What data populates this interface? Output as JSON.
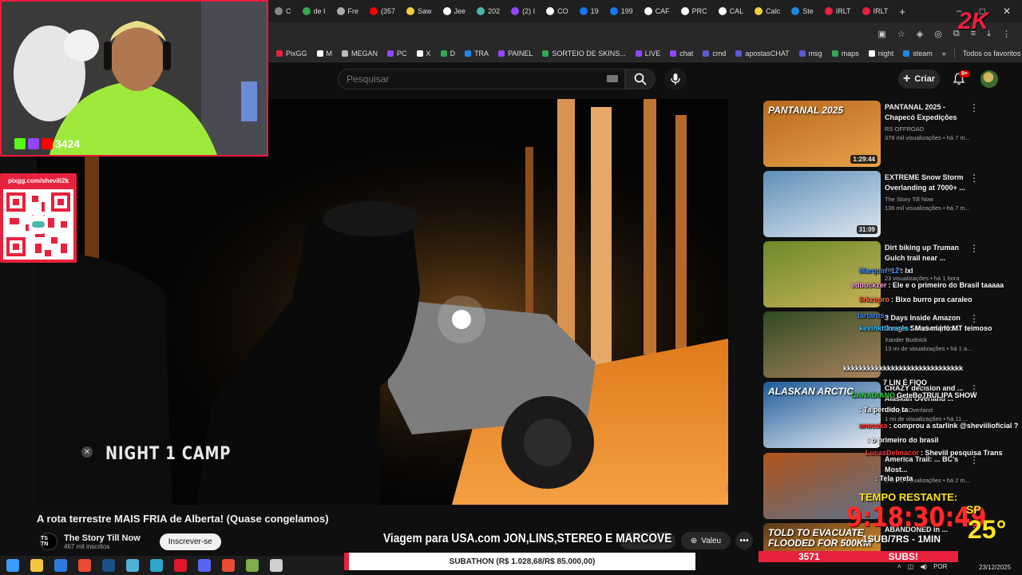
{
  "browser": {
    "tabs": [
      {
        "label": "C",
        "color": "#888888"
      },
      {
        "label": "de I",
        "color": "#34a853"
      },
      {
        "label": "Fre",
        "color": "#aaaaaa"
      },
      {
        "label": "(357",
        "color": "#ff0000"
      },
      {
        "label": "Saw",
        "color": "#f4d03f"
      },
      {
        "label": "Jee",
        "color": "#ffffff"
      },
      {
        "label": "202",
        "color": "#4db6ac"
      },
      {
        "label": "(2) I",
        "color": "#9146ff"
      },
      {
        "label": "CO",
        "color": "#ffffff"
      },
      {
        "label": "19",
        "color": "#1877f2"
      },
      {
        "label": "199",
        "color": "#1877f2"
      },
      {
        "label": "CAF",
        "color": "#ffffff"
      },
      {
        "label": "PRC",
        "color": "#ffffff"
      },
      {
        "label": "CAL",
        "color": "#ffffff"
      },
      {
        "label": "Calc",
        "color": "#f4d03f"
      },
      {
        "label": "Ste",
        "color": "#1e88e5"
      },
      {
        "label": "IRLT",
        "color": "#e8213d"
      },
      {
        "label": "IRLT",
        "color": "#e8213d"
      }
    ],
    "new_tab": "+",
    "window_controls": [
      "−",
      "□",
      "✕"
    ],
    "bookmarks": [
      {
        "label": "PixGG",
        "color": "#e8213d"
      },
      {
        "label": "M",
        "color": "#ffffff"
      },
      {
        "label": "MEGAN",
        "color": "#bbbbbb"
      },
      {
        "label": "PC",
        "color": "#9146ff"
      },
      {
        "label": "X",
        "color": "#ffffff"
      },
      {
        "label": "D",
        "color": "#34a853"
      },
      {
        "label": "TRA",
        "color": "#1e88e5"
      },
      {
        "label": "PAINEL",
        "color": "#9146ff"
      },
      {
        "label": "SORTEIO DE SKINS...",
        "color": "#34a853"
      },
      {
        "label": "LIVE",
        "color": "#9146ff"
      },
      {
        "label": "chat",
        "color": "#9146ff"
      },
      {
        "label": "cmd",
        "color": "#5b5bd6"
      },
      {
        "label": "apostasCHAT",
        "color": "#5b5bd6"
      },
      {
        "label": "msg",
        "color": "#5b5bd6"
      },
      {
        "label": "maps",
        "color": "#34a853"
      },
      {
        "label": "night",
        "color": "#ffffff"
      },
      {
        "label": "steam",
        "color": "#1e88e5"
      }
    ],
    "bookmarks_more": "»",
    "all_favorites": "Todos os favoritos"
  },
  "youtube": {
    "search_placeholder": "Pesquisar",
    "create_label": "Criar",
    "notifications_badge": "9+",
    "video": {
      "overlay_caption": "NIGHT 1 CAMP",
      "title": "A rota terrestre MAIS FRIA de Alberta! (Quase congelamos)",
      "channel": "The Story Till Now",
      "channel_initials": "TS TN",
      "subscribers": "467 mil inscritos",
      "subscribe_label": "Inscrever-se",
      "like_label": "Valeu",
      "more_label": "•••"
    },
    "recommendations": [
      {
        "title": "PANTANAL 2025 - Chapecó Expedições",
        "channel": "RS OFFROAD",
        "meta": "378 mil visualizações • há 7 m...",
        "duration": "1:29:44",
        "thumb_colors": [
          "#b86a1c",
          "#e6a24a"
        ],
        "thumb_text": "PANTANAL 2025"
      },
      {
        "title": "EXTREME Snow Storm Overlanding at 7000+ ...",
        "channel": "The Story Till Now",
        "meta": "136 mil visualizações • há 7 m...",
        "duration": "31:09",
        "thumb_colors": [
          "#5f8fb8",
          "#dfe8f0"
        ],
        "thumb_text": ""
      },
      {
        "title": "Dirt biking up Truman Gulch trail near ...",
        "channel": "Joe Pr...",
        "meta": "23 visualizações • há 1 hora",
        "duration": "",
        "thumb_colors": [
          "#6b8a2a",
          "#c9b25a"
        ],
        "thumb_text": ""
      },
      {
        "title": "3 Days Inside Amazon Jungle Survival | No ...",
        "channel": "Xander Budnick",
        "meta": "13 mi de visualizações • há 1 a...",
        "duration": "",
        "thumb_colors": [
          "#2f4a22",
          "#a9835e"
        ],
        "thumb_text": ""
      },
      {
        "title": "CRAZY decision and ... Alaskan Overland ...",
        "channel": "Lifestyle Overland",
        "meta": "1 mi de visualizações • há 11 ...",
        "duration": "",
        "thumb_colors": [
          "#1d5a9a",
          "#e9eef2"
        ],
        "thumb_text": "ALASKAN ARCTIC"
      },
      {
        "title": "America Trail: ... BC's Most...",
        "channel": "",
        "meta": "142 mil visualizações • há 2 m...",
        "duration": "",
        "thumb_colors": [
          "#b2541c",
          "#5d6f86"
        ],
        "thumb_text": ""
      },
      {
        "title": "ABANDONED in ...",
        "channel": "",
        "meta": "",
        "duration": "",
        "thumb_colors": [
          "#5a3a1a",
          "#d48a28"
        ],
        "thumb_text": "TOLD TO EVACUATE FLOODED FOR 500KM"
      }
    ]
  },
  "stream": {
    "viewer_count": "3424",
    "pix_url": "pixgg.com/shevili2k",
    "marquee": "Viagem para USA.com JON,LINS,STEREO E MARCOVE",
    "subathon": "SUBATHON (R$ 1.028,68/R$ 85.000,00)",
    "timer_label": "TEMPO RESTANTE:",
    "timer": "9:18:30:49",
    "weather_city": "SP",
    "weather_temp": "25°",
    "goal_left": "3571",
    "goal_right": "SUBS!",
    "goal_mid": "1SUB/7RS - 1MIN",
    "brand": "2K",
    "chat": [
      {
        "user": "Marquin_12",
        "msg": ": lxl",
        "color": "#3b8cff"
      },
      {
        "user": "edbuckzer",
        "msg": ": Ele e o primeiro do Brasil taaaaa",
        "color": "#ff9de0"
      },
      {
        "user": "lirkzopro",
        "msg": ": Bixo burro pra caraleo",
        "color": "#ff6b3b"
      },
      {
        "user": "tartaros_",
        "msg": "",
        "color": "#3b8cff"
      },
      {
        "user": "kevinkttavares",
        "msg": ": Mas mano MT teimoso",
        "color": "#3bc3ff"
      },
      {
        "user": "",
        "msg": "kkkkkkkkkkkkkkkkkkkkkkkkkkkkkk",
        "color": "#ffffff"
      },
      {
        "user": "7 LIN É FIQO",
        "msg": "",
        "color": "#ffffff"
      },
      {
        "user": "CANADIANO",
        "msg": "GeteBoTRULIPA SHOW",
        "color": "#2fd24a"
      },
      {
        "user": "",
        "msg": ": Ta perdido ta",
        "color": "#ffffff"
      },
      {
        "user": "anscaka",
        "msg": ": comprou a starlink @sheviilioficial ?",
        "color": "#ff3b3b"
      },
      {
        "user": "",
        "msg": ": o primeiro do brasil",
        "color": "#ffffff"
      },
      {
        "user": "LucasDelmacor",
        "msg": ": Sheviil pesquisa Trans",
        "color": "#ff3b3b"
      },
      {
        "user": "",
        "msg": ": Tela preta",
        "color": "#ffffff"
      }
    ]
  },
  "taskbar": {
    "icons": [
      {
        "name": "windows-start-icon",
        "color": "#3b9cff"
      },
      {
        "name": "file-explorer-icon",
        "color": "#f4c542"
      },
      {
        "name": "store-icon",
        "color": "#2b7bdc"
      },
      {
        "name": "chrome-icon",
        "color": "#e94b35"
      },
      {
        "name": "steam-icon",
        "color": "#1b4f87"
      },
      {
        "name": "app-icon",
        "color": "#4fb0d8"
      },
      {
        "name": "edge-icon",
        "color": "#2ca7c9"
      },
      {
        "name": "opera-icon",
        "color": "#e0182d"
      },
      {
        "name": "discord-icon",
        "color": "#5865f2"
      },
      {
        "name": "chrome-active-icon",
        "color": "#e94b35"
      },
      {
        "name": "game-icon",
        "color": "#7fae4a"
      },
      {
        "name": "calculator-icon",
        "color": "#cfcfcf"
      }
    ],
    "lang": "POR",
    "date": "23/12/2025"
  }
}
